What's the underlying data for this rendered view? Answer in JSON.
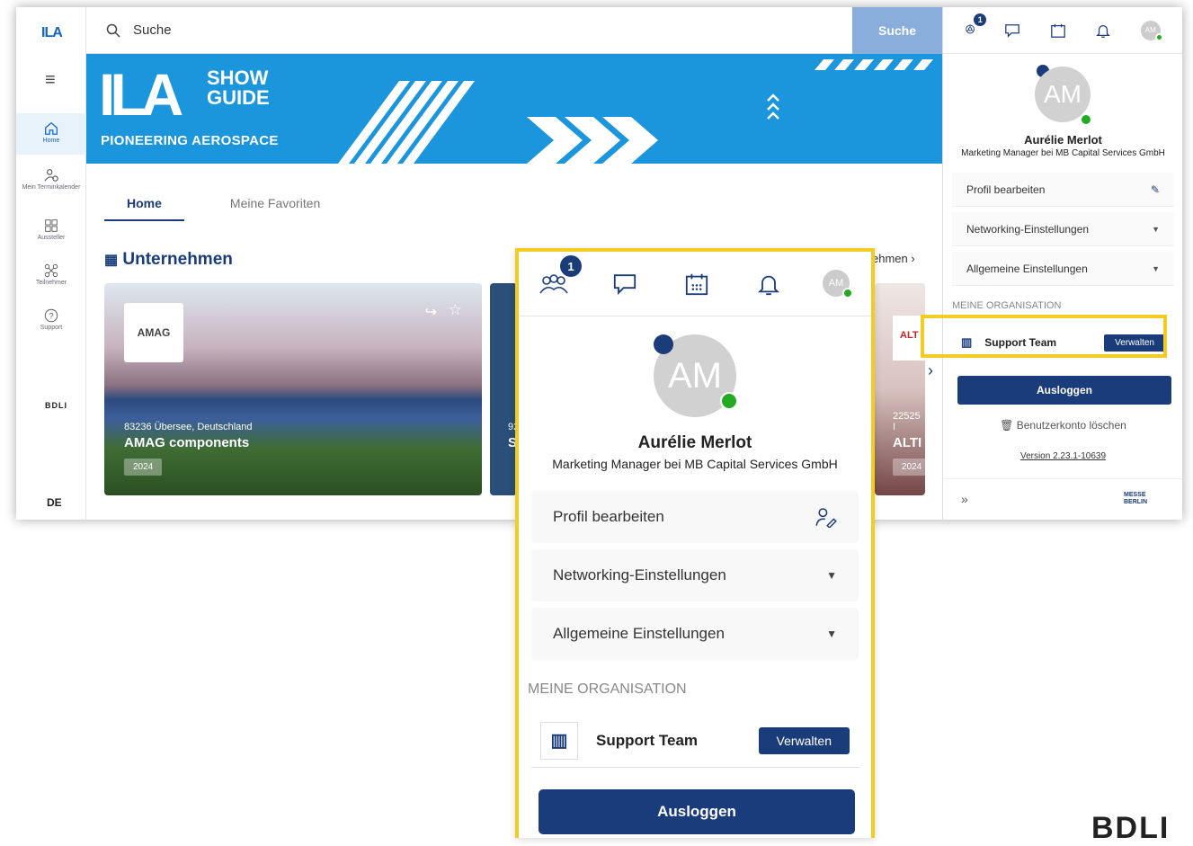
{
  "app": {
    "logo": "ILA",
    "lang": "DE",
    "partner_logo": "BDLI"
  },
  "nav": [
    {
      "label": "Home",
      "icon": "home-icon"
    },
    {
      "label": "Mein Terminkalender",
      "icon": "calendar-person-icon"
    },
    {
      "label": "Aussteller",
      "icon": "grid-icon"
    },
    {
      "label": "Teilnehmer",
      "icon": "network-icon"
    },
    {
      "label": "Support",
      "icon": "help-icon"
    }
  ],
  "search": {
    "placeholder": "Suche",
    "button": "Suche"
  },
  "banner": {
    "logo": "ILA",
    "line1": "SHOW",
    "line2": "GUIDE",
    "tagline": "PIONEERING AEROSPACE"
  },
  "tabs": [
    {
      "label": "Home"
    },
    {
      "label": "Meine Favoriten"
    }
  ],
  "section": {
    "title": "Unternehmen",
    "link": "ehmen ›"
  },
  "cards": [
    {
      "logo": "AMAG",
      "location": "83236 Übersee, Deutschland",
      "name": "AMAG components",
      "year": "2024"
    },
    {
      "logo": "",
      "location": "92",
      "name": "S",
      "year": ""
    },
    {
      "logo": "ALT",
      "location": "22525 I",
      "name": "ALTI",
      "year": "2024"
    }
  ],
  "profile": {
    "initials": "AM",
    "name": "Aurélie Merlot",
    "role": "Marketing Manager bei MB Capital Services GmbH",
    "notification_count": "1",
    "edit_profile": "Profil bearbeiten",
    "networking": "Networking-Einstellungen",
    "general": "Allgemeine Einstellungen",
    "org_heading": "MEINE ORGANISATION",
    "org_name": "Support Team",
    "manage": "Verwalten",
    "logout": "Ausloggen",
    "delete_account": "Benutzerkonto löschen",
    "version": "Version 2.23.1-10639",
    "footer_logo": "MESSE BERLIN",
    "collapse": "»"
  },
  "colors": {
    "primary": "#1a3c7a",
    "banner": "#1b95dc",
    "highlight": "#f2cc22",
    "online": "#22aa22"
  }
}
